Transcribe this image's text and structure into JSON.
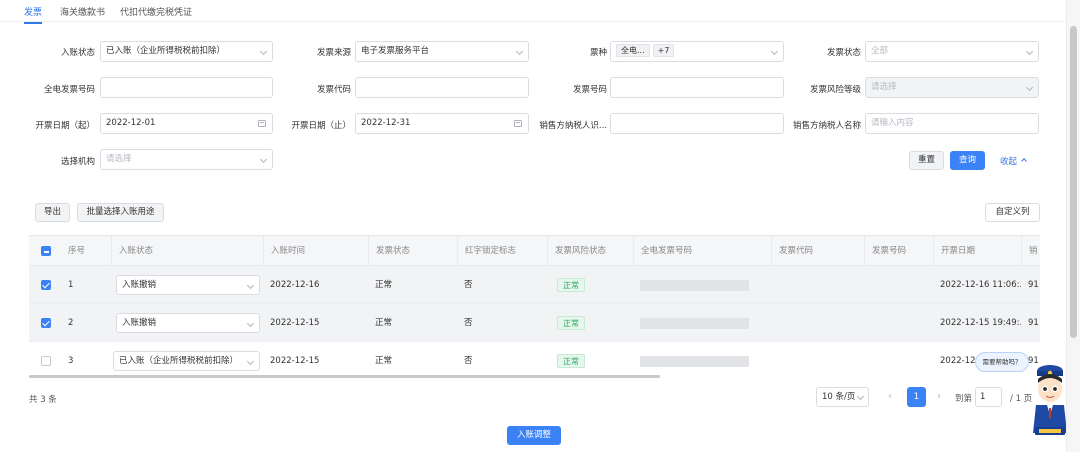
{
  "tabs": [
    "发票",
    "海关缴款书",
    "代扣代缴完税凭证"
  ],
  "filters": {
    "entry_status": {
      "label": "入账状态",
      "value": "已入账（企业所得税税前扣除）"
    },
    "invoice_source": {
      "label": "发票来源",
      "value": "电子发票服务平台"
    },
    "ticket_type": {
      "label": "票种",
      "tag": "全电...",
      "more": "+7"
    },
    "invoice_status": {
      "label": "发票状态",
      "placeholder": "全部"
    },
    "full_elec_no": {
      "label": "全电发票号码",
      "value": ""
    },
    "invoice_code": {
      "label": "发票代码",
      "value": ""
    },
    "invoice_no": {
      "label": "发票号码",
      "value": ""
    },
    "risk_level": {
      "label": "发票风险等级",
      "placeholder": "请选择"
    },
    "date_start": {
      "label": "开票日期（起）",
      "value": "2022-12-01"
    },
    "date_end": {
      "label": "开票日期（止）",
      "value": "2022-12-31"
    },
    "seller_tax_id": {
      "label": "销售方纳税人识...",
      "value": ""
    },
    "seller_name": {
      "label": "销售方纳税人名称",
      "placeholder": "请输入内容"
    },
    "org": {
      "label": "选择机构",
      "placeholder": "请选择"
    }
  },
  "buttons": {
    "reset": "重置",
    "query": "查询",
    "collapse": "收起",
    "export": "导出",
    "batch": "批量选择入账用途",
    "customize": "自定义列",
    "adjust": "入账调整"
  },
  "table": {
    "headers": [
      "序号",
      "入账状态",
      "入账时间",
      "发票状态",
      "红字锁定标志",
      "发票风险状态",
      "全电发票号码",
      "发票代码",
      "发票号码",
      "开票日期",
      "销"
    ],
    "rows": [
      {
        "checked": true,
        "no": "1",
        "status": "入账撤销",
        "time": "2022-12-16",
        "inv_status": "正常",
        "red_lock": "否",
        "risk": "正常",
        "date": "2022-12-16 11:06:...",
        "tail": "91"
      },
      {
        "checked": true,
        "no": "2",
        "status": "入账撤销",
        "time": "2022-12-15",
        "inv_status": "正常",
        "red_lock": "否",
        "risk": "正常",
        "date": "2022-12-15 19:49:...",
        "tail": "91"
      },
      {
        "checked": false,
        "no": "3",
        "status": "已入账（企业所得税税前扣除）",
        "time": "2022-12-15",
        "inv_status": "正常",
        "red_lock": "否",
        "risk": "正常",
        "date": "2022-12-",
        "tail": "91"
      }
    ]
  },
  "pagination": {
    "total": "共 3 条",
    "page_size": "10 条/页",
    "current": "1",
    "goto_label": "到第",
    "goto_value": "1",
    "pages": "/ 1 页"
  },
  "assistant": {
    "bubble": "需要帮助吗？"
  },
  "colors": {
    "primary": "#3b82f6",
    "success": "#2aa55f",
    "link": "#3276e8"
  }
}
